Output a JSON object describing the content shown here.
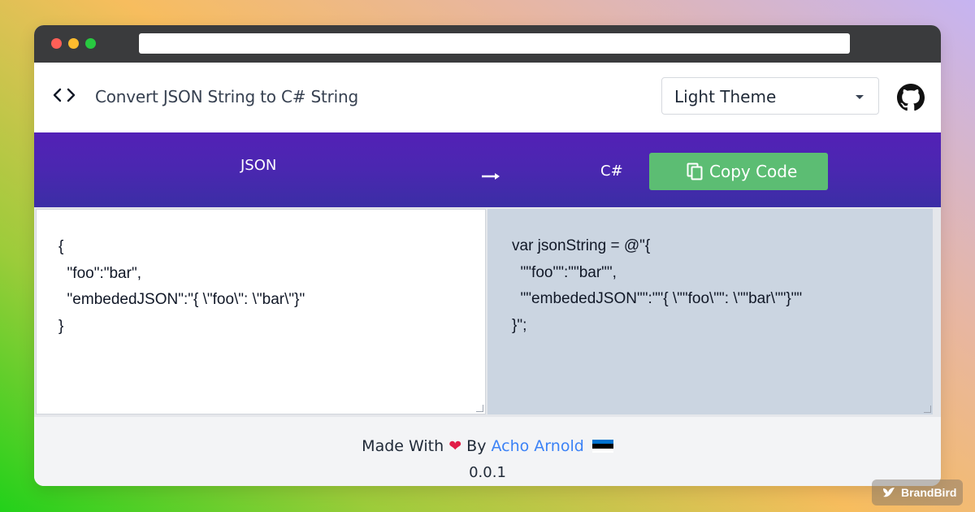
{
  "header": {
    "title": "Convert JSON String to C# String",
    "theme_select": {
      "value": "Light Theme"
    }
  },
  "toolbar": {
    "source_label": "JSON",
    "target_label": "C#",
    "copy_label": "Copy Code"
  },
  "editor": {
    "input": "{\n  \"foo\":\"bar\",\n  \"embededJSON\":\"{ \\\"foo\\\": \\\"bar\\\"}\"\n}",
    "output": "var jsonString = @\"{\n  \"\"foo\"\":\"\"bar\"\",\n  \"\"embededJSON\"\":\"\"{ \\\"\"foo\\\"\": \\\"\"bar\\\"\"}\"\"\n}\";"
  },
  "footer": {
    "made_with": "Made With",
    "by": "By",
    "author": "Acho Arnold",
    "version": "0.0.1"
  },
  "watermark": {
    "text": "BrandBird"
  },
  "colors": {
    "accent": "#4a27b0",
    "copy_button": "#5cbd73",
    "link": "#3b82f6",
    "heart": "#e11d48"
  },
  "icons": [
    "code-icon",
    "github-icon",
    "arrow-right-icon",
    "copy-icon",
    "heart-icon",
    "estonia-flag-icon"
  ]
}
